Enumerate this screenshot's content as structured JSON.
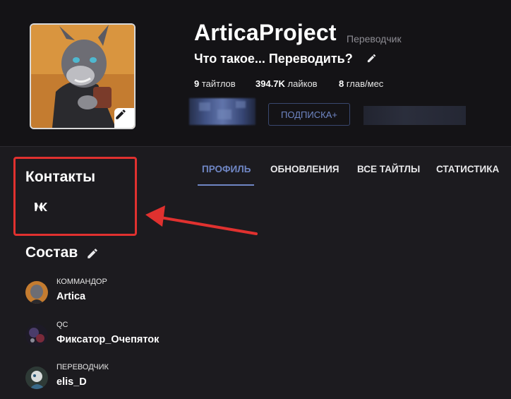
{
  "profile": {
    "name": "ArticaProject",
    "role": "Переводчик",
    "tagline": "Что такое... Переводить?",
    "stats": [
      {
        "value": "9",
        "label": " тайтлов"
      },
      {
        "value": "394.7K",
        "label": " лайков"
      },
      {
        "value": "8",
        "label": " глав/мес"
      }
    ],
    "subscribe_label": "ПОДПИСКА+"
  },
  "contacts": {
    "title": "Контакты",
    "vk_label": "VK"
  },
  "tabs": [
    {
      "label": "ПРОФИЛЬ",
      "active": true
    },
    {
      "label": "ОБНОВЛЕНИЯ",
      "active": false
    },
    {
      "label": "ВСЕ ТАЙТЛЫ",
      "active": false
    },
    {
      "label": "СТАТИСТИКА",
      "active": false
    }
  ],
  "team": {
    "title": "Состав",
    "members": [
      {
        "role": "КОММАНДОР",
        "name": "Artica"
      },
      {
        "role": "QC",
        "name": "Фиксатор_Очепяток"
      },
      {
        "role": "ПЕРЕВОДЧИК",
        "name": "elis_D"
      }
    ]
  },
  "colors": {
    "accent": "#6f86c4",
    "highlight_annotation": "#e0312f",
    "background": "#1c1b1f",
    "header_background": "#141316"
  },
  "icons": {
    "avatar_edit": "pencil-icon",
    "tagline_edit": "pencil-icon",
    "team_edit": "pencil-icon",
    "contact": "vk-icon"
  }
}
